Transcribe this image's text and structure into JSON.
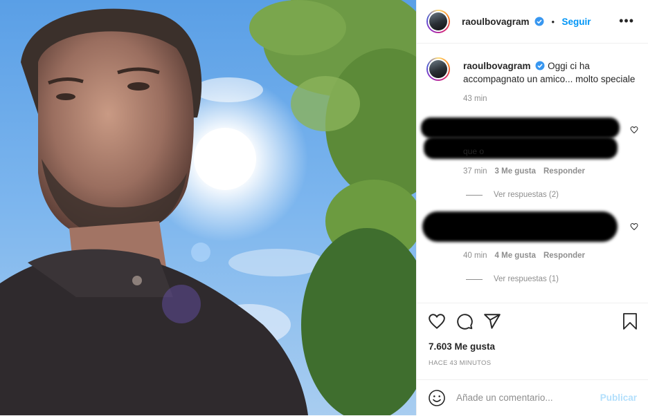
{
  "post": {
    "username": "raoulbovagram",
    "follow_label": "Seguir",
    "dot": "•",
    "more_label": "•••",
    "caption": "Oggi ci ha accompagnato un amico... molto speciale",
    "caption_time": "43 min",
    "photo_alt": "Selfie bajo el sol entre árboles"
  },
  "comments": [
    {
      "fragment": "que o",
      "time": "37 min",
      "likes": "3 Me gusta",
      "reply": "Responder",
      "replies": "Ver respuestas (2)"
    },
    {
      "time": "40 min",
      "likes": "4 Me gusta",
      "reply": "Responder",
      "replies": "Ver respuestas (1)"
    }
  ],
  "footer": {
    "likes": "7.603 Me gusta",
    "ago": "HACE 43 MINUTOS",
    "comment_placeholder": "Añade un comentario...",
    "post_label": "Publicar"
  },
  "icons": [
    "verified-badge-icon",
    "more-options-icon",
    "heart-icon",
    "comment-icon",
    "share-icon",
    "bookmark-icon",
    "emoji-icon"
  ],
  "colors": {
    "accent": "#0095f6",
    "muted": "#8e8e8e",
    "publish_disabled": "#b2dffc"
  }
}
